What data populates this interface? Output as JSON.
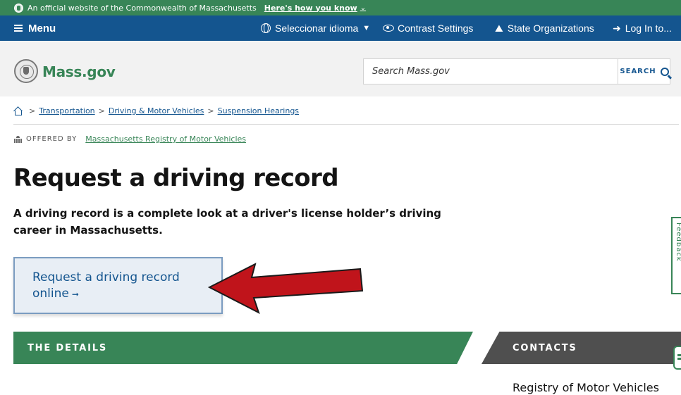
{
  "banner": {
    "official_text": "An official website of the Commonwealth of Massachusetts",
    "howto_label": "Here's how you know"
  },
  "util_nav": {
    "menu_label": "Menu",
    "language_label": "Seleccionar idioma",
    "contrast_label": "Contrast Settings",
    "orgs_label": "State Organizations",
    "login_label": "Log In to..."
  },
  "header": {
    "logo_text": "Mass.gov",
    "search_placeholder": "Search Mass.gov",
    "search_button": "SEARCH"
  },
  "breadcrumb": {
    "items": [
      "Transportation",
      "Driving & Motor Vehicles",
      "Suspension Hearings"
    ]
  },
  "offered_by": {
    "label": "OFFERED BY",
    "org": "Massachusetts Registry of Motor Vehicles"
  },
  "page": {
    "title": "Request a driving record",
    "lede": "A driving record is a complete look at a driver's license holder’s driving career in Massachusetts."
  },
  "cta": {
    "line1": "Request a driving record",
    "line2": "online"
  },
  "tabs": {
    "details": "THE DETAILS",
    "contacts": "CONTACTS"
  },
  "contacts": {
    "first_name": "Registry of Motor Vehicles"
  },
  "colors": {
    "brand_green": "#388557",
    "nav_blue": "#14558f",
    "annotation_red": "#c0141b"
  },
  "feedback_label": "Feedback"
}
